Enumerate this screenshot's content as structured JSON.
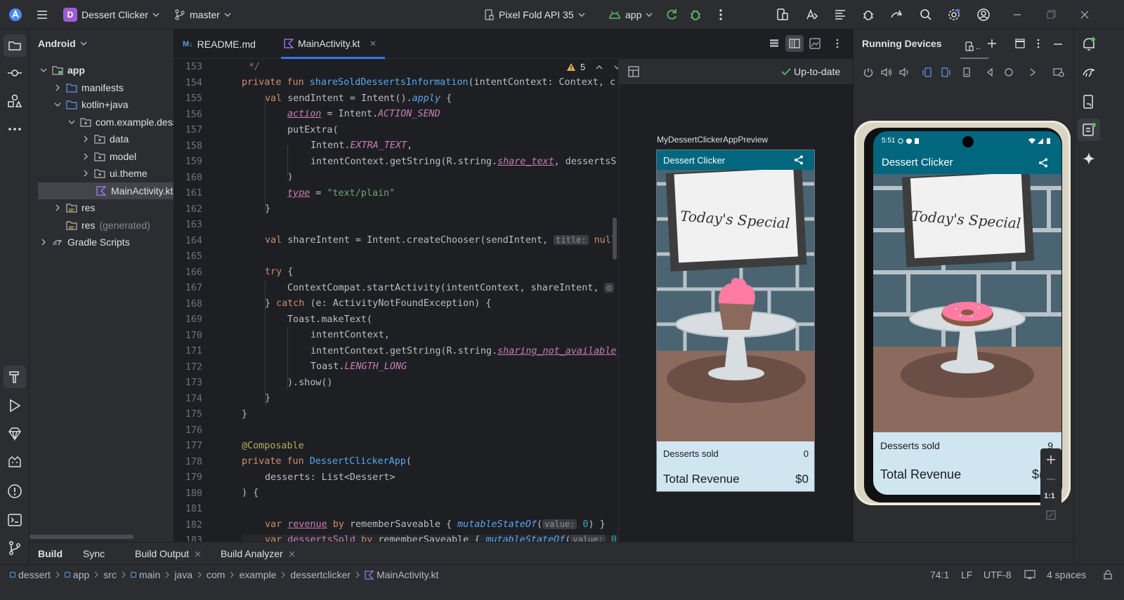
{
  "titlebar": {
    "project_badge": "D",
    "project_name": "Dessert Clicker",
    "branch": "master",
    "device": "Pixel Fold API 35",
    "run_config": "app"
  },
  "project_panel": {
    "view": "Android",
    "tree": [
      {
        "label": "app",
        "bold": true
      },
      {
        "label": "manifests"
      },
      {
        "label": "kotlin+java"
      },
      {
        "label": "com.example.dess"
      },
      {
        "label": "data"
      },
      {
        "label": "model"
      },
      {
        "label": "ui.theme"
      },
      {
        "label": "MainActivity.kt"
      },
      {
        "label": "res"
      },
      {
        "label": "res",
        "suffix": "(generated)"
      },
      {
        "label": "Gradle Scripts"
      }
    ]
  },
  "editor": {
    "tabs": [
      {
        "prefix": "M↓",
        "label": "README.md"
      },
      {
        "label": "MainActivity.kt"
      }
    ],
    "warnings": "5"
  },
  "code": {
    "line_numbers": [
      "153",
      "154",
      "155",
      "156",
      "157",
      "158",
      "159",
      "160",
      "161",
      "162",
      "163",
      "164",
      "165",
      "166",
      "167",
      "168",
      "169",
      "170",
      "171",
      "172",
      "173",
      "174",
      "175",
      "176",
      "177",
      "178",
      "179",
      "180",
      "181",
      "182",
      "183"
    ],
    "l153": "*/",
    "l154a": "private fun ",
    "l154b": "shareSoldDessertsInformation",
    "l154c": "(intentContext: Context, c",
    "l155a": "val ",
    "l155b": "sendIntent = Intent().",
    "l155c": "apply",
    "l155d": " {",
    "l156a": "action",
    "l156b": " = Intent.",
    "l156c": "ACTION_SEND",
    "l157": "putExtra(",
    "l158a": "Intent.",
    "l158b": "EXTRA_TEXT",
    "l158c": ",",
    "l159a": "intentContext.getString(R.string.",
    "l159b": "share_text",
    "l159c": ", dessertsS",
    "l160": ")",
    "l161a": "type",
    "l161b": " = ",
    "l161c": "\"text/plain\"",
    "l162": "}",
    "l164a": "val ",
    "l164b": "shareIntent = Intent.createChooser(sendIntent, ",
    "l164hint": "title:",
    "l164c": " null)",
    "l166a": "try",
    "l166b": " {",
    "l167": "ContextCompat.startActivity(intentContext, shareIntent, ",
    "l167hint": "o",
    "l168a": "} ",
    "l168b": "catch",
    "l168c": " (e: ActivityNotFoundException) {",
    "l169": "Toast.makeText(",
    "l170": "intentContext,",
    "l171a": "intentContext.getString(R.string.",
    "l171b": "sharing_not_available",
    "l172a": "Toast.",
    "l172b": "LENGTH_LONG",
    "l173": ").show()",
    "l174": "}",
    "l175": "}",
    "l177": "@Composable",
    "l178a": "private fun ",
    "l178b": "DessertClickerApp",
    "l178c": "(",
    "l179": "desserts: List<Dessert>",
    "l180": ") {",
    "l182a": "var ",
    "l182b": "revenue",
    "l182c": " by ",
    "l182d": "rememberSaveable",
    "l182e": " { ",
    "l182f": "mutableStateOf",
    "l182g": "(",
    "l182hint": "value:",
    "l182h": " 0",
    "l182i": ") }",
    "l183a": "var ",
    "l183b": "dessertsSold",
    "l183c": " by ",
    "l183d": "rememberSaveable",
    "l183e": " { ",
    "l183f": "mutableStateOf",
    "l183g": "(",
    "l183hint": "value:",
    "l183h": " 0"
  },
  "preview": {
    "status": "Up-to-date",
    "name": "MyDessertClickerAppPreview",
    "app_title": "Dessert Clicker",
    "sign_text": "Today's Special",
    "desserts_sold_label": "Desserts sold",
    "desserts_sold_value": "0",
    "revenue_label": "Total Revenue",
    "revenue_value": "$0"
  },
  "running_devices": {
    "title": "Running Devices",
    "tab_more": "..",
    "device_time": "5:51",
    "app_title": "Dessert Clicker",
    "sign_text": "Today's Special",
    "desserts_sold_label": "Desserts sold",
    "desserts_sold_value": "9",
    "revenue_label": "Total Revenue",
    "revenue_value": "$(",
    "zoom_ratio": "1:1"
  },
  "bottom_tabs": {
    "build": "Build",
    "sync": "Sync",
    "build_output": "Build Output",
    "build_analyzer": "Build Analyzer"
  },
  "statusbar": {
    "crumbs": [
      "dessert",
      "app",
      "src",
      "main",
      "java",
      "com",
      "example",
      "dessertclicker",
      "MainActivity.kt"
    ],
    "position": "74:1",
    "line_sep": "LF",
    "encoding": "UTF-8",
    "indent": "4 spaces"
  },
  "colors": {
    "accent": "#3574f0",
    "app_bar": "#00677f",
    "info_panel": "#cfe6f1"
  }
}
